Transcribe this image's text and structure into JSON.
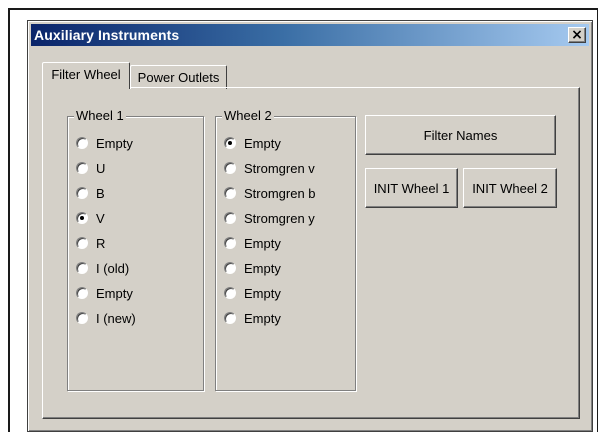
{
  "window": {
    "title": "Auxiliary Instruments",
    "close_label": "×"
  },
  "tabs": [
    {
      "label": "Filter Wheel",
      "active": true
    },
    {
      "label": "Power Outlets",
      "active": false
    }
  ],
  "wheel1": {
    "label": "Wheel 1",
    "options": [
      "Empty",
      "U",
      "B",
      "V",
      "R",
      "I (old)",
      "Empty",
      "I (new)"
    ],
    "selected_index": 3
  },
  "wheel2": {
    "label": "Wheel 2",
    "options": [
      "Empty",
      "Stromgren v",
      "Stromgren b",
      "Stromgren y",
      "Empty",
      "Empty",
      "Empty",
      "Empty"
    ],
    "selected_index": 0
  },
  "buttons": {
    "filter_names": "Filter Names",
    "init_wheel1": "INIT Wheel 1",
    "init_wheel2": "INIT Wheel 2"
  },
  "colors": {
    "titlebar_start": "#0a246a",
    "titlebar_end": "#a6caf0",
    "face": "#d4d0c8"
  }
}
